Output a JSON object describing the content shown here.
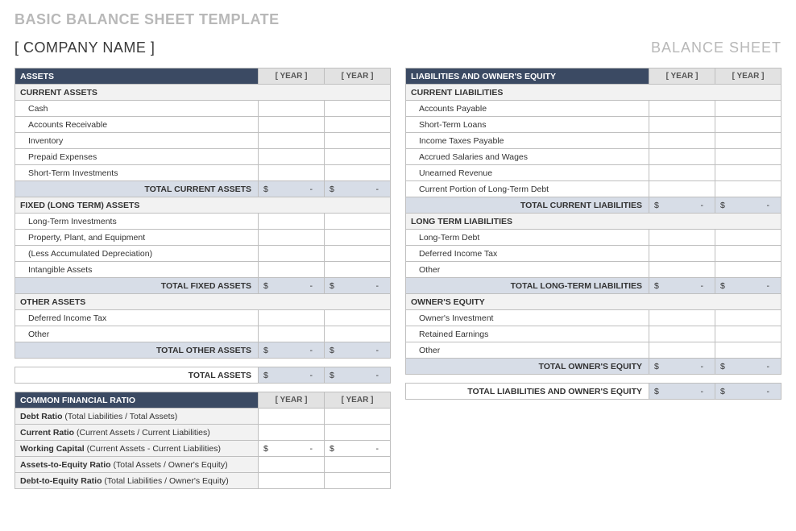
{
  "page_title": "BASIC BALANCE SHEET TEMPLATE",
  "company_name": "[ COMPANY NAME ]",
  "sheet_title": "BALANCE SHEET",
  "year_label": "[ YEAR ]",
  "dollar_dash": {
    "cur": "$",
    "dash": "-"
  },
  "assets": {
    "header": "ASSETS",
    "current": {
      "header": "CURRENT ASSETS",
      "items": [
        "Cash",
        "Accounts Receivable",
        "Inventory",
        "Prepaid Expenses",
        "Short-Term Investments"
      ],
      "total_label": "TOTAL CURRENT ASSETS"
    },
    "fixed": {
      "header": "FIXED (LONG TERM) ASSETS",
      "items": [
        "Long-Term Investments",
        "Property, Plant, and Equipment",
        "(Less Accumulated Depreciation)",
        "Intangible Assets"
      ],
      "total_label": "TOTAL FIXED ASSETS"
    },
    "other": {
      "header": "OTHER ASSETS",
      "items": [
        "Deferred Income Tax",
        "Other"
      ],
      "total_label": "TOTAL OTHER ASSETS"
    },
    "grand_total_label": "TOTAL ASSETS"
  },
  "liab_equity": {
    "header": "LIABILITIES AND OWNER'S EQUITY",
    "current_liab": {
      "header": "CURRENT LIABILITIES",
      "items": [
        "Accounts Payable",
        "Short-Term Loans",
        "Income Taxes Payable",
        "Accrued Salaries and Wages",
        "Unearned Revenue",
        "Current Portion of Long-Term Debt"
      ],
      "total_label": "TOTAL CURRENT LIABILITIES"
    },
    "long_term_liab": {
      "header": "LONG TERM LIABILITIES",
      "items": [
        "Long-Term Debt",
        "Deferred Income Tax",
        "Other"
      ],
      "total_label": "TOTAL LONG-TERM LIABILITIES"
    },
    "owners_equity": {
      "header": "OWNER'S EQUITY",
      "items": [
        "Owner's Investment",
        "Retained Earnings",
        "Other"
      ],
      "total_label": "TOTAL OWNER'S EQUITY"
    },
    "grand_total_label": "TOTAL LIABILITIES AND OWNER'S EQUITY"
  },
  "ratios": {
    "header": "COMMON FINANCIAL RATIO",
    "rows": [
      {
        "name": "Debt Ratio",
        "desc": " (Total Liabilities / Total Assets)",
        "money": false
      },
      {
        "name": "Current Ratio",
        "desc": " (Current Assets / Current Liabilities)",
        "money": false
      },
      {
        "name": "Working Capital",
        "desc": " (Current Assets - Current Liabilities)",
        "money": true
      },
      {
        "name": "Assets-to-Equity Ratio",
        "desc": " (Total Assets / Owner's Equity)",
        "money": false
      },
      {
        "name": "Debt-to-Equity Ratio",
        "desc": " (Total Liabilities / Owner's Equity)",
        "money": false
      }
    ]
  }
}
